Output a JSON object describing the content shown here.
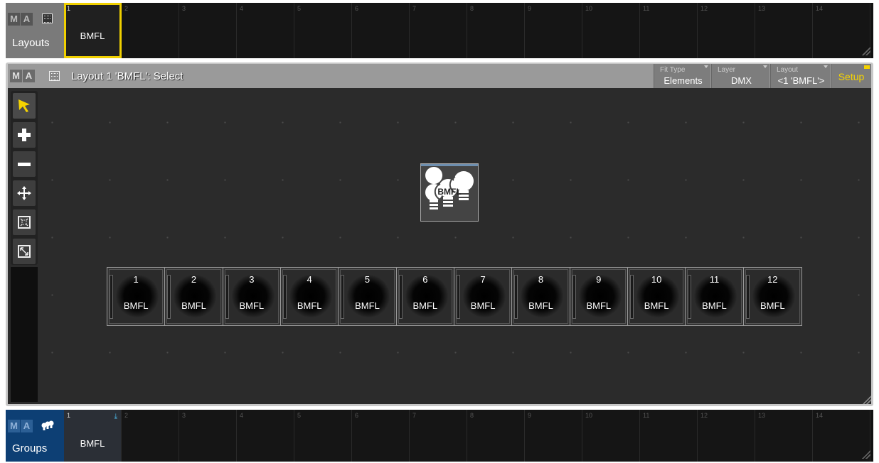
{
  "layouts_pool": {
    "logo": [
      "M",
      "A"
    ],
    "title": "Layouts",
    "icon": "layout-grid-icon",
    "cells": [
      {
        "num": "1",
        "name": "BMFL"
      },
      {
        "num": "2",
        "name": ""
      },
      {
        "num": "3",
        "name": ""
      },
      {
        "num": "4",
        "name": ""
      },
      {
        "num": "5",
        "name": ""
      },
      {
        "num": "6",
        "name": ""
      },
      {
        "num": "7",
        "name": ""
      },
      {
        "num": "8",
        "name": ""
      },
      {
        "num": "9",
        "name": ""
      },
      {
        "num": "10",
        "name": ""
      },
      {
        "num": "11",
        "name": ""
      },
      {
        "num": "12",
        "name": ""
      },
      {
        "num": "13",
        "name": ""
      },
      {
        "num": "14",
        "name": ""
      }
    ],
    "selected_cell": "1",
    "selected_color": "#f0d000"
  },
  "layout_window": {
    "logo": [
      "M",
      "A"
    ],
    "title": "Layout 1 'BMFL': Select",
    "fit_type": {
      "label": "Fit Type",
      "value": "Elements"
    },
    "layer": {
      "label": "Layer",
      "value": "DMX"
    },
    "layout": {
      "label": "Layout",
      "value": "<1 'BMFL'>"
    },
    "setup": {
      "label": "Setup",
      "color": "#f5d300"
    },
    "tools": [
      "select-arrow-icon",
      "zoom-in-icon",
      "zoom-out-icon",
      "move-icon",
      "fit-to-elements-icon",
      "fit-to-screen-icon"
    ],
    "active_tool": "select-arrow-icon",
    "group_element": {
      "label": "BMFL",
      "icon": "bulbs-icon"
    },
    "fixtures": [
      {
        "num": "1",
        "name": "BMFL"
      },
      {
        "num": "2",
        "name": "BMFL"
      },
      {
        "num": "3",
        "name": "BMFL"
      },
      {
        "num": "4",
        "name": "BMFL"
      },
      {
        "num": "5",
        "name": "BMFL"
      },
      {
        "num": "6",
        "name": "BMFL"
      },
      {
        "num": "7",
        "name": "BMFL"
      },
      {
        "num": "8",
        "name": "BMFL"
      },
      {
        "num": "9",
        "name": "BMFL"
      },
      {
        "num": "10",
        "name": "BMFL"
      },
      {
        "num": "11",
        "name": "BMFL"
      },
      {
        "num": "12",
        "name": "BMFL"
      }
    ]
  },
  "groups_pool": {
    "logo": [
      "M",
      "A"
    ],
    "title": "Groups",
    "icon": "group-bulbs-icon",
    "cells": [
      {
        "num": "1",
        "name": "BMFL"
      },
      {
        "num": "2",
        "name": ""
      },
      {
        "num": "3",
        "name": ""
      },
      {
        "num": "4",
        "name": ""
      },
      {
        "num": "5",
        "name": ""
      },
      {
        "num": "6",
        "name": ""
      },
      {
        "num": "7",
        "name": ""
      },
      {
        "num": "8",
        "name": ""
      },
      {
        "num": "9",
        "name": ""
      },
      {
        "num": "10",
        "name": ""
      },
      {
        "num": "11",
        "name": ""
      },
      {
        "num": "12",
        "name": ""
      },
      {
        "num": "13",
        "name": ""
      },
      {
        "num": "14",
        "name": ""
      }
    ],
    "accent_color": "#0d3f74"
  }
}
